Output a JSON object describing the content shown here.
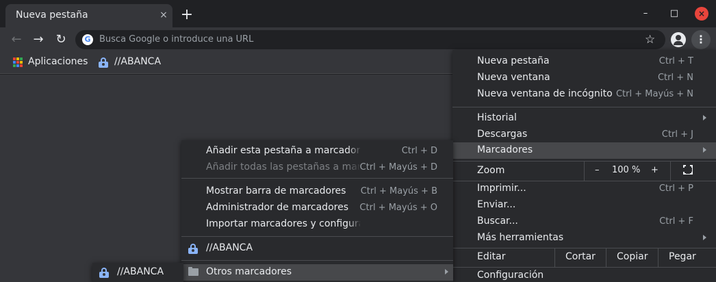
{
  "tab": {
    "title": "Nueva pestaña"
  },
  "icons": {
    "close": "×",
    "new_tab": "+",
    "minimize": "–",
    "maximize": "□",
    "win_close": "×",
    "back": "←",
    "forward": "→",
    "reload": "↻",
    "star": "☆",
    "menu": "⋮",
    "google": "G"
  },
  "omnibox": {
    "placeholder": "Busca Google o introduce una URL"
  },
  "bookmarks_bar": {
    "apps": "Aplicaciones",
    "abanca": "//ABANCA"
  },
  "apps_colors": [
    "#ea4335",
    "#fbbc04",
    "#34a853",
    "#4285f4",
    "#ea4335",
    "#fbbc04",
    "#34a853",
    "#4285f4",
    "#ea4335"
  ],
  "main_menu": {
    "new_tab": {
      "label": "Nueva pestaña",
      "shortcut": "Ctrl + T"
    },
    "new_window": {
      "label": "Nueva ventana",
      "shortcut": "Ctrl + N"
    },
    "incognito": {
      "label": "Nueva ventana de incógnito",
      "shortcut": "Ctrl + Mayús + N"
    },
    "history": {
      "label": "Historial"
    },
    "downloads": {
      "label": "Descargas",
      "shortcut": "Ctrl + J"
    },
    "bookmarks": {
      "label": "Marcadores"
    },
    "zoom": {
      "label": "Zoom",
      "minus": "–",
      "value": "100 %",
      "plus": "+"
    },
    "print": {
      "label": "Imprimir...",
      "shortcut": "Ctrl + P"
    },
    "cast": {
      "label": "Enviar..."
    },
    "find": {
      "label": "Buscar...",
      "shortcut": "Ctrl + F"
    },
    "more_tools": {
      "label": "Más herramientas"
    },
    "edit": {
      "label": "Editar",
      "cut": "Cortar",
      "copy": "Copiar",
      "paste": "Pegar"
    },
    "settings": {
      "label": "Configuración"
    }
  },
  "bookmarks_menu": {
    "add_tab": {
      "label": "Añadir esta pestaña a marcadores...",
      "shortcut": "Ctrl + D"
    },
    "add_all": {
      "label": "Añadir todas las pestañas a marcadores...",
      "shortcut": "Ctrl + Mayús + D"
    },
    "show_bar": {
      "label": "Mostrar barra de marcadores",
      "shortcut": "Ctrl + Mayús + B"
    },
    "manager": {
      "label": "Administrador de marcadores",
      "shortcut": "Ctrl + Mayús + O"
    },
    "import": {
      "label": "Importar marcadores y configuración..."
    },
    "abanca": {
      "label": "//ABANCA"
    },
    "other": {
      "label": "Otros marcadores"
    }
  },
  "other_bookmarks_menu": {
    "abanca": {
      "label": "//ABANCA"
    }
  }
}
